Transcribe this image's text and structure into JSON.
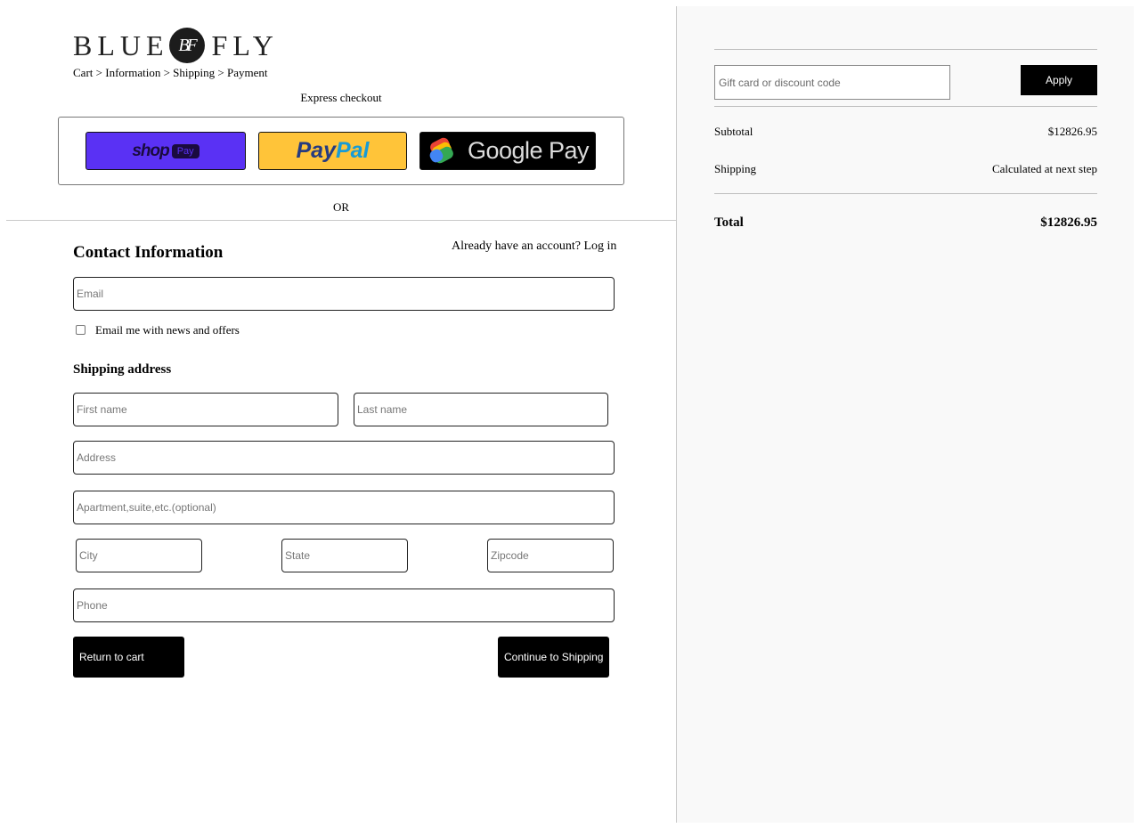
{
  "brand": {
    "left_word": "BLUE",
    "monogram": "BF",
    "right_word": "FLY"
  },
  "breadcrumb": [
    "Cart",
    "Information",
    "Shipping",
    "Payment"
  ],
  "breadcrumb_separator": ">",
  "express": {
    "title": "Express checkout",
    "shop_pay": {
      "word": "shop",
      "pill": "Pay"
    },
    "paypal": {
      "part1": "Pay",
      "part2": "Pal"
    },
    "google_pay": {
      "label": "Google Pay"
    },
    "or_text": "OR"
  },
  "contact": {
    "title": "Contact Information",
    "login_prompt": "Already have an account?",
    "login_link": "Log in",
    "email_placeholder": "Email",
    "newsletter_label": "Email me with news and offers",
    "newsletter_checked": false
  },
  "shipping": {
    "title": "Shipping address",
    "first_name_placeholder": "First name",
    "last_name_placeholder": "Last name",
    "address_placeholder": "Address",
    "apartment_placeholder": "Apartment,suite,etc.(optional)",
    "city_placeholder": "City",
    "state_placeholder": "State",
    "zipcode_placeholder": "Zipcode",
    "phone_placeholder": "Phone"
  },
  "actions": {
    "return_label": "Return to cart",
    "continue_label": "Continue to Shipping"
  },
  "summary": {
    "discount_placeholder": "Gift card or discount code",
    "apply_label": "Apply",
    "subtotal_label": "Subtotal",
    "subtotal_value": "$12826.95",
    "shipping_label": "Shipping",
    "shipping_value": "Calculated at next step",
    "total_label": "Total",
    "total_value": "$12826.95"
  },
  "colors": {
    "shop_pay": "#5a31f4",
    "paypal": "#ffc439",
    "google_pay": "#000000",
    "summary_bg": "#f9f9f9"
  }
}
